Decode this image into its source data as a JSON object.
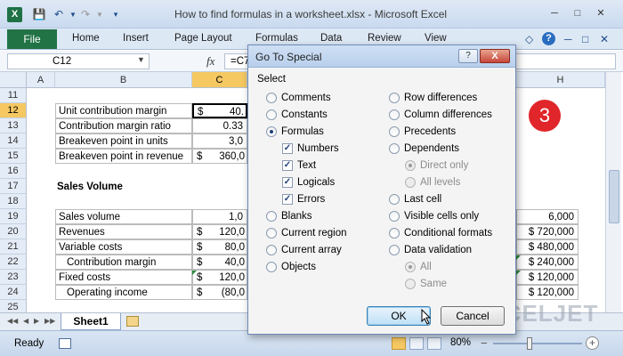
{
  "window": {
    "title": "How to find formulas in a worksheet.xlsx  -  Microsoft Excel",
    "app_icon": "X"
  },
  "ribbon": {
    "file": "File",
    "tabs": [
      "Home",
      "Insert",
      "Page Layout",
      "Formulas",
      "Data",
      "Review",
      "View"
    ],
    "help": "?"
  },
  "formula_bar": {
    "name_box": "C12",
    "fx": "fx",
    "formula": "=C7"
  },
  "grid": {
    "columns": [
      "A",
      "B",
      "C",
      "H"
    ],
    "rows": [
      "11",
      "12",
      "13",
      "14",
      "15",
      "16",
      "17",
      "18",
      "19",
      "20",
      "21",
      "22",
      "23",
      "24",
      "25"
    ],
    "cells": {
      "b12": "Unit contribution margin",
      "c12_sym": "$",
      "c12": "40.",
      "b13": "Contribution margin ratio",
      "c13": "0.33",
      "b14": "Breakeven point in units",
      "c14": "3,0",
      "b15": "Breakeven point in revenue",
      "c15_sym": "$",
      "c15": "360,0",
      "b17": "Sales Volume",
      "b19": "Sales volume",
      "c19": "1,0",
      "h19": "6,000",
      "b20": "Revenues",
      "c20_sym": "$",
      "c20": "120,0",
      "h20": "$ 720,000",
      "b21": "Variable costs",
      "c21_sym": "$",
      "c21": "80,0",
      "h21": "$ 480,000",
      "b22": "Contribution margin",
      "c22_sym": "$",
      "c22": "40,0",
      "h22": "$ 240,000",
      "b23": "Fixed costs",
      "c23_sym": "$",
      "c23": "120,0",
      "h23": "$ 120,000",
      "b24": "Operating income",
      "c24_sym": "$",
      "c24": "(80,0",
      "h24": "$ 120,000"
    },
    "badge": "3"
  },
  "sheet_tabs": {
    "active": "Sheet1"
  },
  "status_bar": {
    "ready": "Ready",
    "zoom": "80%",
    "zoom_minus": "−",
    "zoom_plus": "+",
    "watermark": "EXCELJET"
  },
  "dialog": {
    "title": "Go To Special",
    "help_btn": "?",
    "close_btn": "X",
    "group_label": "Select",
    "left_options": [
      "Comments",
      "Constants",
      "Formulas",
      "Blanks",
      "Current region",
      "Current array",
      "Objects"
    ],
    "formula_subs": [
      "Numbers",
      "Text",
      "Logicals",
      "Errors"
    ],
    "right_options": [
      "Row differences",
      "Column differences",
      "Precedents",
      "Dependents",
      "Last cell",
      "Visible cells only",
      "Conditional formats",
      "Data validation"
    ],
    "dependents_subs": [
      "Direct only",
      "All levels"
    ],
    "validation_subs": [
      "All",
      "Same"
    ],
    "ok": "OK",
    "cancel": "Cancel"
  },
  "colors": {
    "excel_green": "#217346",
    "selection_header": "#f5c862",
    "badge_red": "#e0262b"
  }
}
